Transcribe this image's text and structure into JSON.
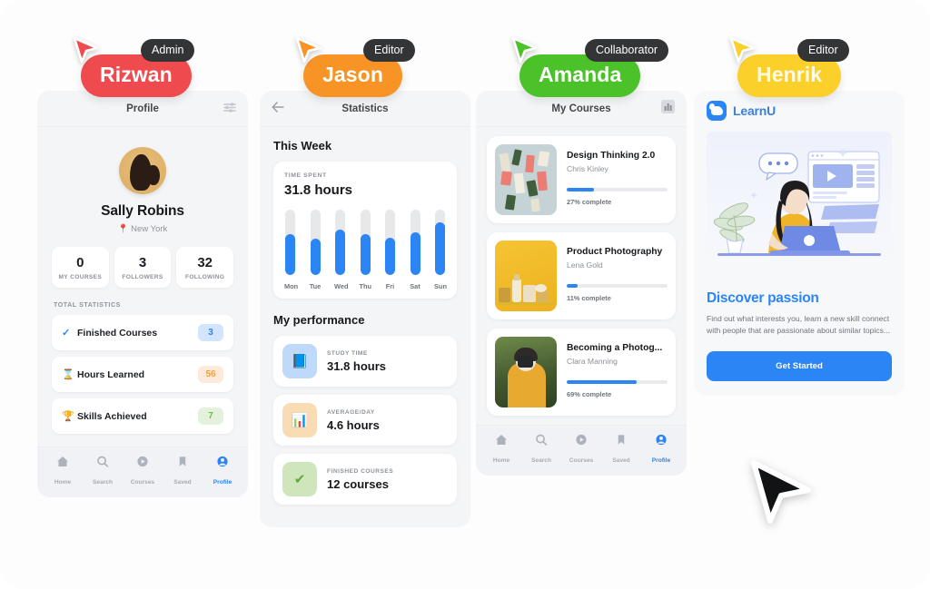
{
  "colors": {
    "accent_blue": "#2b85f5",
    "red": "#ef4b4f",
    "orange": "#f79425",
    "green": "#4cc22a",
    "yellow": "#fbd02b",
    "chip_dark": "#333436",
    "page_bg": "#fdfdfd",
    "panel_bg": "#f4f5f7"
  },
  "collaborators": [
    {
      "name": "Rizwan",
      "role": "Admin",
      "color": "#ef4b4f",
      "cursor_color": "#ef4b4f"
    },
    {
      "name": "Jason",
      "role": "Editor",
      "color": "#f79425",
      "cursor_color": "#f79425"
    },
    {
      "name": "Amanda",
      "role": "Collaborator",
      "color": "#4cc22a",
      "cursor_color": "#4cc22a"
    },
    {
      "name": "Henrik",
      "role": "Editor",
      "color": "#fbd02b",
      "cursor_color": "#fbd02b"
    }
  ],
  "bottom_nav": {
    "items": [
      {
        "label": "Home",
        "icon": "home-icon",
        "active": false
      },
      {
        "label": "Search",
        "icon": "search-icon",
        "active": false
      },
      {
        "label": "Courses",
        "icon": "play-icon",
        "active": false
      },
      {
        "label": "Saved",
        "icon": "bookmark-icon",
        "active": false
      },
      {
        "label": "Profile",
        "icon": "person-icon",
        "active": true
      }
    ]
  },
  "panel1": {
    "title": "Profile",
    "menu_icon": "filter-sliders-icon",
    "avatar": "user-avatar",
    "user_name": "Sally Robins",
    "location": "New York",
    "location_icon": "pin-icon",
    "stats": [
      {
        "value": "0",
        "label": "MY COURSES"
      },
      {
        "value": "3",
        "label": "FOLLOWERS"
      },
      {
        "value": "32",
        "label": "FOLLOWING"
      }
    ],
    "section_caption": "TOTAL STATISTICS",
    "lines": [
      {
        "icon": "check-icon",
        "glyph": "✓",
        "icon_color": "#2b85f5",
        "label": "Finished Courses",
        "value": "3",
        "badge_bg": "#d3e4fd",
        "badge_fg": "#2b85f5"
      },
      {
        "icon": "hourglass-icon",
        "glyph": "⌛",
        "icon_color": "#f0a73c",
        "label": "Hours Learned",
        "value": "56",
        "badge_bg": "#fdeada",
        "badge_fg": "#ee9f33"
      },
      {
        "icon": "trophy-icon",
        "glyph": "🏆",
        "icon_color": "#6fbf3a",
        "label": "Skills Achieved",
        "value": "7",
        "badge_bg": "#e4f2dd",
        "badge_fg": "#76b94a"
      }
    ]
  },
  "panel2": {
    "title": "Statistics",
    "back_icon": "arrow-left-icon",
    "heading": "This Week",
    "card_caption": "TIME SPENT",
    "card_value": "31.8 hours",
    "performance_heading": "My performance",
    "performance": [
      {
        "caption": "STUDY TIME",
        "value": "31.8 hours",
        "icon": "book-icon",
        "glyph": "📘",
        "tile_bg": "#bed9f9"
      },
      {
        "caption": "AVERAGE/DAY",
        "value": "4.6 hours",
        "icon": "bar-chart-icon",
        "glyph": "📊",
        "tile_bg": "#fadcb4"
      },
      {
        "caption": "FINISHED COURSES",
        "value": "12 courses",
        "icon": "double-check-icon",
        "glyph": "✔",
        "tile_bg": "#cfe6bd"
      }
    ]
  },
  "panel3": {
    "title": "My Courses",
    "stats_icon": "bar-chart-icon",
    "courses": [
      {
        "title": "Design Thinking 2.0",
        "author": "Chris Kinley",
        "progress": 27,
        "progress_label": "27% complete",
        "thumb": "sticky-notes-thumb"
      },
      {
        "title": "Product Photography",
        "author": "Lena Gold",
        "progress": 11,
        "progress_label": "11% complete",
        "thumb": "product-shot-thumb"
      },
      {
        "title": "Becoming a Photog...",
        "author": "Clara Manning",
        "progress": 69,
        "progress_label": "69% complete",
        "thumb": "photographer-thumb"
      }
    ]
  },
  "panel4": {
    "brand_name": "LearnU",
    "brand_icon": "learnu-logo-icon",
    "hero_illustration": "woman-at-laptop-illustration",
    "heading": "Discover passion",
    "body": "Find out what interests you, learn a new skill connect with people that are passionate about similar topics...",
    "cta_label": "Get Started"
  },
  "chart_data": {
    "type": "bar",
    "title": "TIME SPENT",
    "subtitle": "31.8 hours",
    "categories": [
      "Mon",
      "Tue",
      "Wed",
      "Thu",
      "Fri",
      "Sat",
      "Sun"
    ],
    "values": [
      62,
      55,
      70,
      63,
      57,
      65,
      80
    ],
    "ylim": [
      0,
      100
    ],
    "xlabel": "",
    "ylabel": "",
    "grid": false,
    "legend": "none",
    "series_color": "#2b85f5",
    "track_color": "#e6e8ea"
  },
  "pointer": {
    "icon": "mouse-pointer-icon"
  }
}
